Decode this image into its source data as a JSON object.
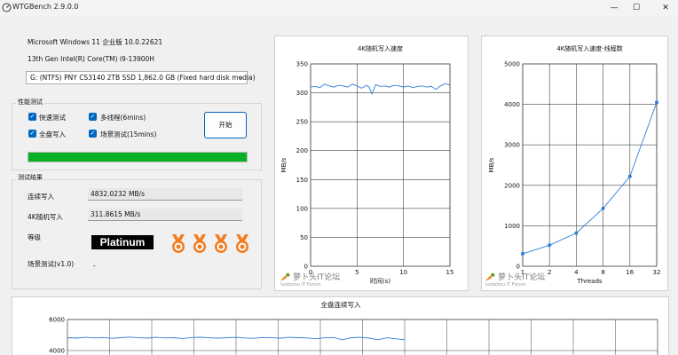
{
  "window": {
    "title": "WTGBench 2.9.0.0",
    "minimize": "—",
    "maximize": "☐",
    "close": "✕"
  },
  "system": {
    "os": "Microsoft Windows 11 企业版 10.0.22621",
    "cpu": "13th Gen Intel(R) Core(TM) i9-13900H",
    "disk": "G:  (NTFS) PNY CS3140 2TB SSD 1,862.0 GB (Fixed hard disk media)"
  },
  "perf_test": {
    "group_label": "性能测试",
    "options": [
      {
        "label": "快速测试",
        "checked": true
      },
      {
        "label": "多线程(6mins)",
        "checked": true
      },
      {
        "label": "全盘写入",
        "checked": true
      },
      {
        "label": "场景测试(15mins)",
        "checked": true
      }
    ],
    "start_label": "开始",
    "progress": 1.0,
    "progress_color": "#06b025"
  },
  "results": {
    "group_label": "测试结果",
    "seq_write_label": "连续写入",
    "seq_write_value": "4832.0232 MB/s",
    "rand4k_label": "4K随机写入",
    "rand4k_value": "311.8615 MB/s",
    "grade_label": "等级",
    "grade_value": "Platinum",
    "medal_count": 4,
    "medal_color": "#f07d22",
    "scene_label": "场景测试(v1.0)",
    "scene_value": "-"
  },
  "watermark": {
    "name": "萝卜头IT论坛",
    "sub": "luobotou IT Forum"
  },
  "chart_data": [
    {
      "type": "line",
      "title": "4K随机写入速度",
      "xlabel": "时间(s)",
      "ylabel": "MB/s",
      "xlim": [
        0,
        15
      ],
      "ylim": [
        0,
        350
      ],
      "xticks": [
        0,
        5,
        10,
        15
      ],
      "yticks": [
        0,
        50,
        100,
        150,
        200,
        250,
        300,
        350
      ],
      "tick_labels_x": [
        "0",
        "5",
        "10",
        "15"
      ],
      "tick_labels_y": [
        "0",
        "50",
        "100",
        "150",
        "200",
        "250",
        "300",
        "350"
      ],
      "grid": true,
      "x": [
        0,
        0.5,
        1,
        1.5,
        2,
        2.5,
        3,
        3.5,
        4,
        4.5,
        5,
        5.5,
        6,
        6.3,
        6.6,
        7,
        7.5,
        8,
        8.5,
        9,
        9.5,
        10,
        10.5,
        11,
        11.5,
        12,
        12.5,
        13,
        13.5,
        14,
        14.5,
        15
      ],
      "y": [
        310,
        311,
        309,
        315,
        312,
        310,
        313,
        312,
        310,
        315,
        312,
        308,
        313,
        310,
        298,
        314,
        311,
        312,
        310,
        313,
        312,
        310,
        312,
        309,
        311,
        312,
        310,
        311,
        306,
        312,
        316,
        313
      ],
      "color": "#2f7fd8"
    },
    {
      "type": "line",
      "title": "4K随机写入速度-线程数",
      "xlabel": "Threads",
      "ylabel": "MB/s",
      "ylim": [
        0,
        5000
      ],
      "categories": [
        "1",
        "2",
        "4",
        "8",
        "16",
        "32"
      ],
      "yticks": [
        0,
        1000,
        2000,
        3000,
        4000,
        5000
      ],
      "tick_labels_y": [
        "0",
        "1000",
        "2000",
        "3000",
        "4000",
        "5000"
      ],
      "grid": true,
      "values": [
        310,
        520,
        820,
        1430,
        2220,
        4050
      ],
      "color": "#2f7fd8"
    },
    {
      "type": "line",
      "title": "全盘连续写入",
      "ylim": [
        4000,
        6000
      ],
      "yticks": [
        4000,
        6000
      ],
      "tick_labels_y": [
        "4000",
        "6000"
      ],
      "grid": true,
      "x": [
        0,
        10,
        20,
        30,
        40,
        50,
        60,
        70,
        80,
        90,
        100,
        110,
        120,
        130,
        140,
        150,
        160,
        170,
        180,
        190,
        200,
        210,
        220,
        230,
        240,
        250,
        260,
        270,
        280,
        290,
        300,
        310,
        320,
        330,
        340,
        350,
        360,
        370,
        380
      ],
      "y": [
        4830,
        4800,
        4850,
        4810,
        4840,
        4790,
        4830,
        4870,
        4820,
        4800,
        4850,
        4810,
        4830,
        4780,
        4840,
        4860,
        4820,
        4800,
        4830,
        4850,
        4810,
        4790,
        4840,
        4820,
        4800,
        4850,
        4830,
        4810,
        4760,
        4820,
        4840,
        4700,
        4830,
        4850,
        4800,
        4700,
        4820,
        4760,
        4700
      ],
      "color": "#2f7fd8"
    }
  ]
}
